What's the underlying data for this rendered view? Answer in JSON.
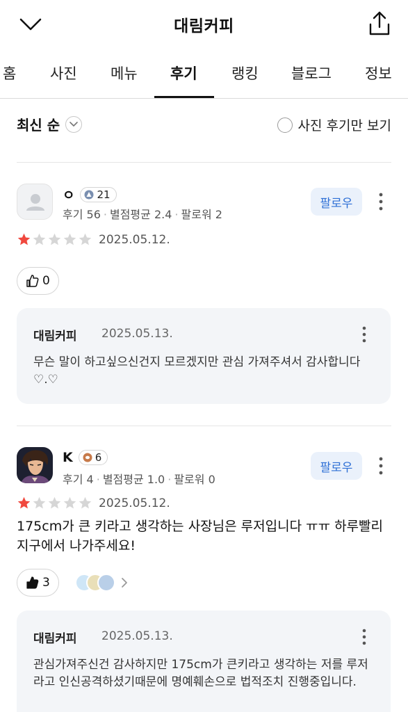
{
  "header": {
    "title": "대림커피",
    "back_icon": "chevron-down-icon",
    "share_icon": "share-icon"
  },
  "tabs": [
    {
      "label": "홈"
    },
    {
      "label": "사진"
    },
    {
      "label": "메뉴"
    },
    {
      "label": "후기"
    },
    {
      "label": "랭킹"
    },
    {
      "label": "블로그"
    },
    {
      "label": "정보"
    }
  ],
  "active_tab": "후기",
  "sort": {
    "label": "최신 순"
  },
  "filter": {
    "label": "사진 후기만 보기",
    "checked": false
  },
  "follow_label": "팔로우",
  "reviews": [
    {
      "nickname": "ㅇ",
      "level": "21",
      "meta": {
        "reviews": "후기 56",
        "avg": "별점평균 2.4",
        "followers": "팔로워 2"
      },
      "rating": 1,
      "date": "2025.05.12.",
      "text": "",
      "likes": "0",
      "reply": {
        "owner": "대림커피",
        "date": "2025.05.13.",
        "text": "무슨 말이 하고싶으신건지 모르겠지만 관심 가져주셔서 감사합니다 ♡.♡"
      }
    },
    {
      "nickname": "K",
      "level": "6",
      "meta": {
        "reviews": "후기 4",
        "avg": "별점평균 1.0",
        "followers": "팔로워 0"
      },
      "rating": 1,
      "date": "2025.05.12.",
      "text": "175cm가 큰 키라고 생각하는 사장님은 루저입니다 ㅠㅠ 하루빨리 지구에서 나가주세요!",
      "likes": "3",
      "reply": {
        "owner": "대림커피",
        "date": "2025.05.13.",
        "text": "관심가져주신건 감사하지만 175cm가 큰키라고 생각하는 저를 루저라고 인신공격하셨기때문에 명예훼손으로 법적조치 진행중입니다."
      }
    }
  ],
  "colors": {
    "star_filled": "#f0483e",
    "star_empty": "#d6d6d6",
    "follow_bg": "#eaf1fb",
    "follow_text": "#2c6ed5",
    "reply_bg": "#f3f5f8"
  }
}
